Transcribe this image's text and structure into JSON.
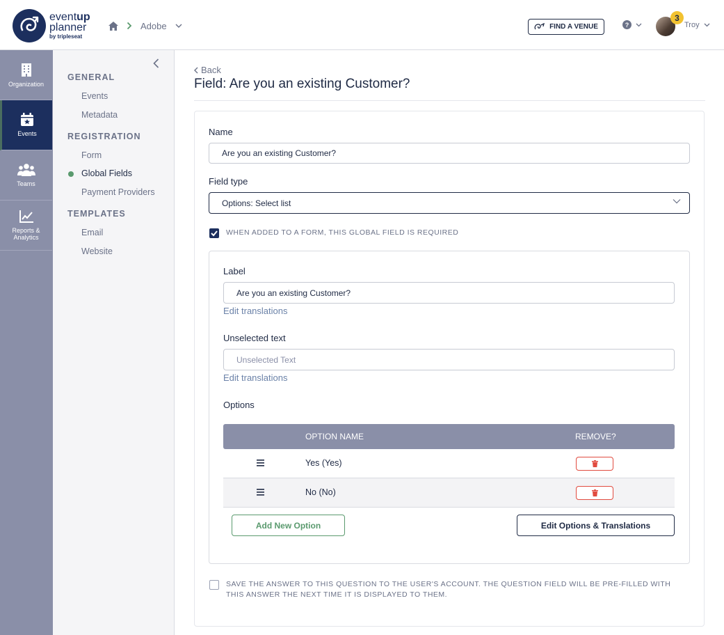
{
  "brand": {
    "logo_line1_a": "event",
    "logo_line1_b": "up",
    "logo_line2": "planner",
    "logo_line3": "by tripleseat",
    "navy": "#1c2f5e",
    "green": "#5a9a6e",
    "danger": "#e14b3f"
  },
  "header": {
    "breadcrumb_org": "Adobe",
    "find_venue": "FIND A VENUE",
    "notifications_count": "3",
    "user_name": "Troy"
  },
  "rail": {
    "items": [
      {
        "label": "Organization",
        "icon": "building-icon"
      },
      {
        "label": "Events",
        "icon": "calendar-star-icon"
      },
      {
        "label": "Teams",
        "icon": "people-icon"
      },
      {
        "label": "Reports & Analytics",
        "icon": "chart-line-icon"
      }
    ]
  },
  "submenu": {
    "general": "GENERAL",
    "events": "Events",
    "metadata": "Metadata",
    "registration": "REGISTRATION",
    "form": "Form",
    "global_fields": "Global Fields",
    "payment_providers": "Payment Providers",
    "templates": "TEMPLATES",
    "email": "Email",
    "website": "Website"
  },
  "page": {
    "back": "Back",
    "title": "Field: Are you an existing Customer?"
  },
  "form": {
    "name_label": "Name",
    "name_value": "Are you an existing Customer?",
    "field_type_label": "Field type",
    "field_type_value": "Options: Select list",
    "required_text": "WHEN ADDED TO A FORM, THIS GLOBAL FIELD IS REQUIRED",
    "label_label": "Label",
    "label_value": "Are you an existing Customer?",
    "edit_translations": "Edit translations",
    "unselected_label": "Unselected text",
    "unselected_placeholder": "Unselected Text",
    "options_label": "Options",
    "col_option_name": "OPTION NAME",
    "col_remove": "REMOVE?",
    "options": [
      {
        "name": "Yes (Yes)"
      },
      {
        "name": "No (No)"
      }
    ],
    "add_option": "Add New Option",
    "edit_options": "Edit Options & Translations",
    "save_answer_text": "SAVE THE ANSWER TO THIS QUESTION TO THE USER'S ACCOUNT. THE QUESTION FIELD WILL BE PRE-FILLED WITH THIS ANSWER THE NEXT TIME IT IS DISPLAYED TO THEM."
  }
}
